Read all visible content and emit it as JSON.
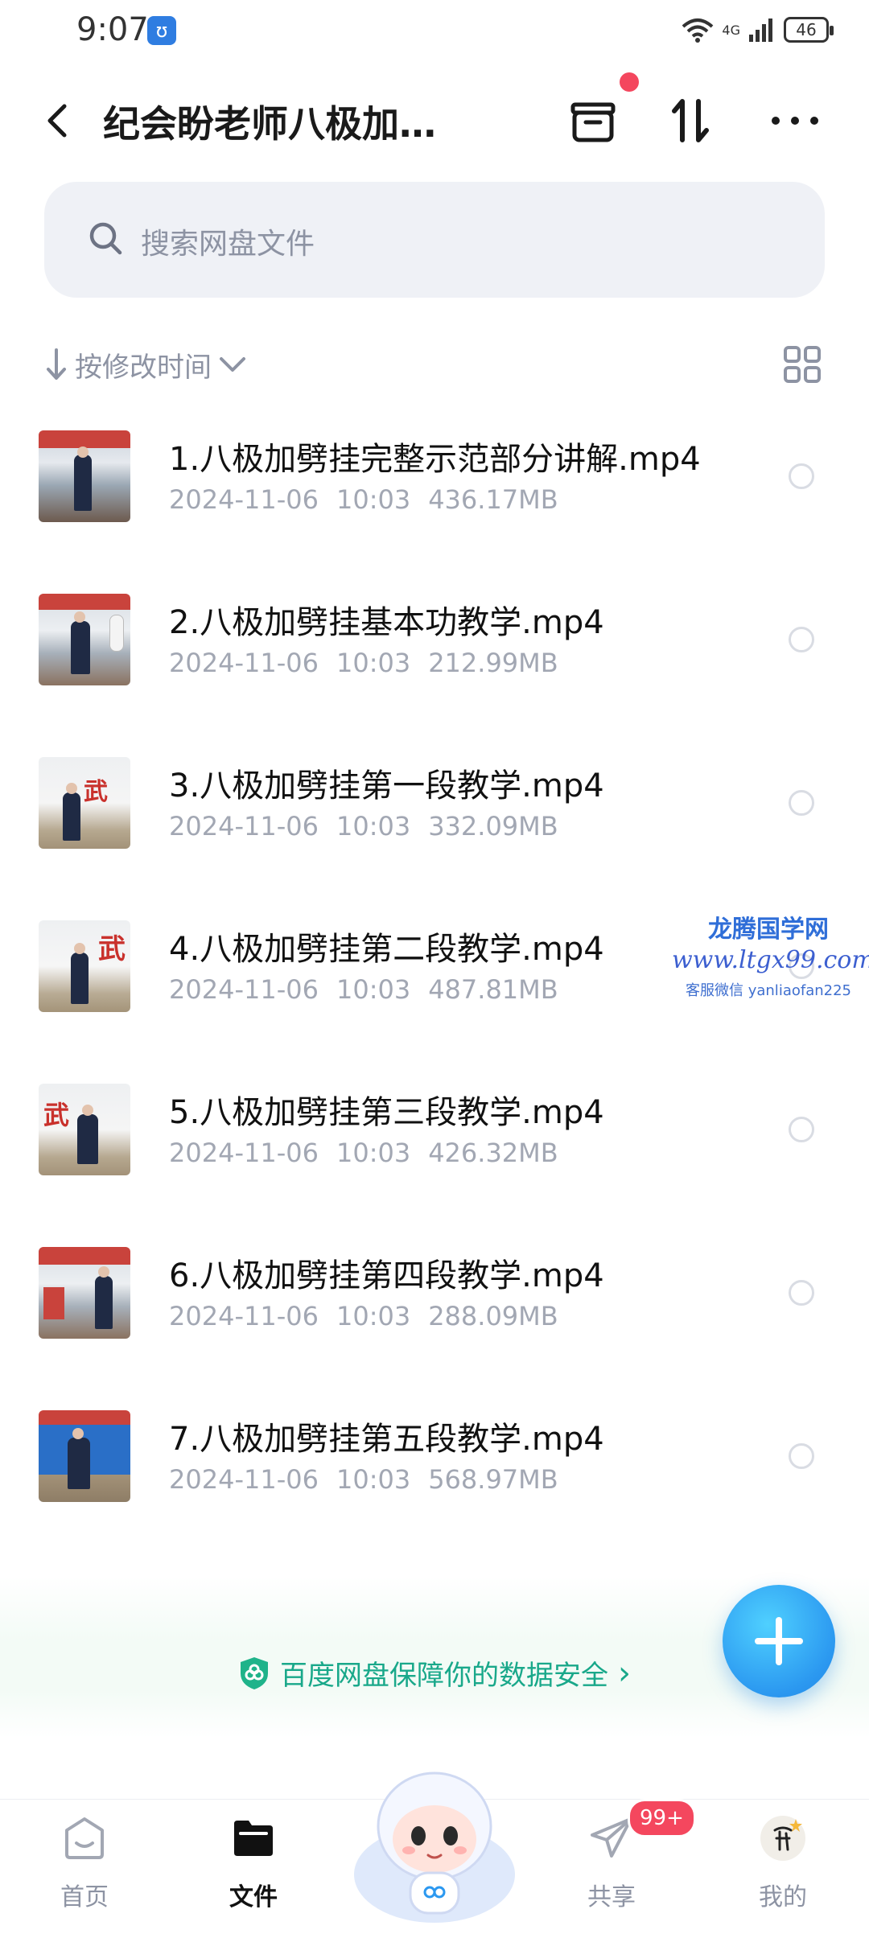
{
  "status_bar": {
    "time": "9:07",
    "app_badge": "ʊ",
    "network": "4G",
    "battery": "46"
  },
  "header": {
    "title": "纪会盼老师八极加…",
    "icons": [
      "back-icon",
      "trash-box-icon",
      "transfer-icon",
      "more-icon"
    ]
  },
  "search": {
    "placeholder": "搜索网盘文件"
  },
  "sort": {
    "label": "按修改时间"
  },
  "files": [
    {
      "name": "1.八极加劈挂完整示范部分讲解.mp4",
      "date": "2024-11-06",
      "time": "10:03",
      "size": "436.17MB"
    },
    {
      "name": "2.八极加劈挂基本功教学.mp4",
      "date": "2024-11-06",
      "time": "10:03",
      "size": "212.99MB"
    },
    {
      "name": "3.八极加劈挂第一段教学.mp4",
      "date": "2024-11-06",
      "time": "10:03",
      "size": "332.09MB"
    },
    {
      "name": "4.八极加劈挂第二段教学.mp4",
      "date": "2024-11-06",
      "time": "10:03",
      "size": "487.81MB"
    },
    {
      "name": "5.八极加劈挂第三段教学.mp4",
      "date": "2024-11-06",
      "time": "10:03",
      "size": "426.32MB"
    },
    {
      "name": "6.八极加劈挂第四段教学.mp4",
      "date": "2024-11-06",
      "time": "10:03",
      "size": "288.09MB"
    },
    {
      "name": "7.八极加劈挂第五段教学.mp4",
      "date": "2024-11-06",
      "time": "10:03",
      "size": "568.97MB"
    }
  ],
  "watermark": {
    "line1": "龙腾国学网",
    "line2": "www.ltgx99.com",
    "line3": "客服微信 yanliaofan225"
  },
  "banner": {
    "text": "百度网盘保障你的数据安全",
    "arrow": "›"
  },
  "nav": {
    "home": "首页",
    "files": "文件",
    "share": "共享",
    "share_badge": "99+",
    "mine": "我的"
  },
  "colors": {
    "accent": "#2b98f0",
    "security_green": "#19a88a",
    "badge_red": "#f4475e",
    "muted": "#a2a7b3"
  }
}
